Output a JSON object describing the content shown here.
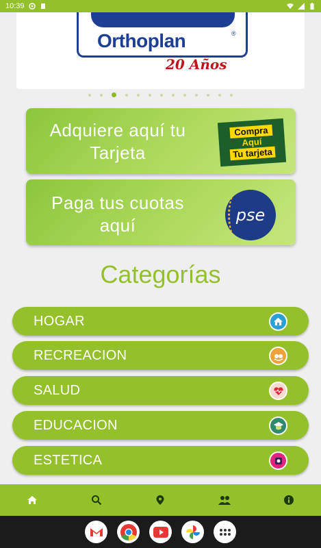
{
  "status_bar": {
    "time": "10:39"
  },
  "banner": {
    "brand": "Orthoplan",
    "registered": "®",
    "years": "20 Años"
  },
  "carousel": {
    "dot_count": 13,
    "active_index": 2
  },
  "promos": {
    "card1": {
      "text": "Adquiere aquí tu Tarjeta",
      "badge_line1": "Compra",
      "badge_line2": "Aquí",
      "badge_line3": "Tu tarjeta"
    },
    "card2": {
      "text": "Paga tus cuotas aquí",
      "badge": "pse"
    }
  },
  "categories": {
    "title": "Categorías",
    "items": [
      {
        "label": "HOGAR",
        "icon": "home-icon"
      },
      {
        "label": "RECREACION",
        "icon": "recreation-icon"
      },
      {
        "label": "SALUD",
        "icon": "heart-pulse-icon"
      },
      {
        "label": "EDUCACION",
        "icon": "education-icon"
      },
      {
        "label": "ESTETICA",
        "icon": "beauty-icon"
      }
    ]
  },
  "bottom_nav": [
    "home-icon",
    "search-icon",
    "location-pin-icon",
    "people-icon",
    "info-icon"
  ],
  "dock_apps": [
    "gmail-icon",
    "chrome-icon",
    "youtube-icon",
    "photos-icon",
    "app-drawer-icon"
  ],
  "colors": {
    "accent": "#94c12b",
    "brand_blue": "#1d3f93",
    "brand_red": "#c0141c"
  }
}
